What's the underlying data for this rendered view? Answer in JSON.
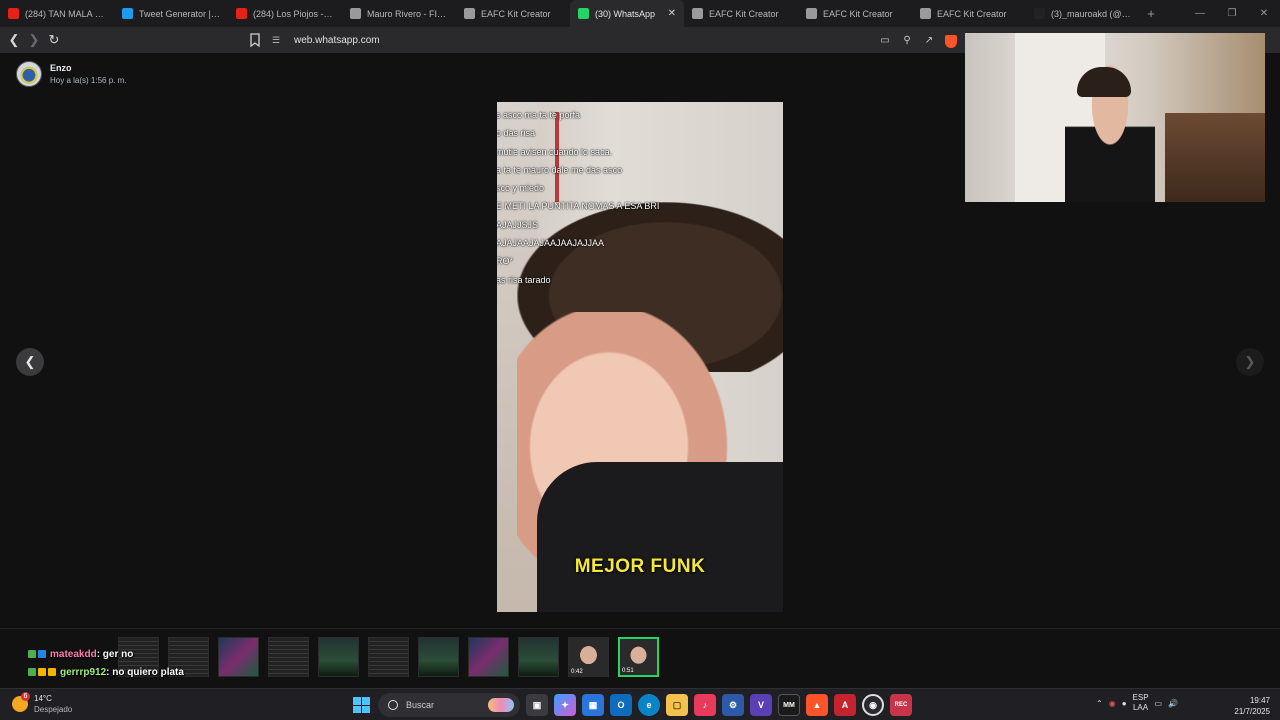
{
  "tabs": [
    {
      "title": "(284) TAN MALA - You",
      "favicon": "youtube-icon",
      "color": "#e62117"
    },
    {
      "title": "Tweet Generator | Twe",
      "favicon": "bird-icon",
      "color": "#1d9bf0"
    },
    {
      "title": "(284) Los Piojos - Pacf",
      "favicon": "youtube-icon",
      "color": "#e62117"
    },
    {
      "title": "Mauro Rivero - FIFA K",
      "favicon": "shirt-icon",
      "color": "#9a9a9e"
    },
    {
      "title": "EAFC Kit Creator",
      "favicon": "shirt-icon",
      "color": "#9a9a9e"
    },
    {
      "title": "(30) WhatsApp",
      "favicon": "whatsapp-icon",
      "color": "#25d366",
      "active": true
    },
    {
      "title": "EAFC Kit Creator",
      "favicon": "shirt-icon",
      "color": "#9a9a9e"
    },
    {
      "title": "EAFC Kit Creator",
      "favicon": "shirt-icon",
      "color": "#9a9a9e"
    },
    {
      "title": "EAFC Kit Creator",
      "favicon": "shirt-icon",
      "color": "#9a9a9e"
    },
    {
      "title": "(3)_mauroakd (@_mau",
      "favicon": "tiktok-icon",
      "color": "#222222"
    }
  ],
  "address": {
    "url": "web.whatsapp.com"
  },
  "sender": {
    "name": "Enzo",
    "time": "Hoy a la(s) 1:56 p. m."
  },
  "media": {
    "overlay_lines": [
      "s asco ma ta te porfa",
      "o das risa",
      "mutie avisen cuando lo saca.",
      "a ta te mauro dale me das asco",
      "sco y miedo",
      "E METI LA PUNTITA NOMAS A ESA BRI",
      "AJAJJSJS",
      "AJAJAAJAJAAJAAJAJJAA",
      "RO*",
      "as risa tarado"
    ],
    "caption": "MEJOR FUNK"
  },
  "chat": [
    {
      "user": "mateakdd",
      "message": ": ger no"
    },
    {
      "user": "gerrrp912",
      "message": ": no quiero plata"
    }
  ],
  "thumbnails": [
    {
      "style": "lines"
    },
    {
      "style": "lines"
    },
    {
      "style": "color"
    },
    {
      "style": "lines"
    },
    {
      "style": "green"
    },
    {
      "style": "lines"
    },
    {
      "style": "green"
    },
    {
      "style": "color"
    },
    {
      "style": "green"
    },
    {
      "style": "face",
      "duration": "0:42"
    },
    {
      "style": "face",
      "duration": "0:51",
      "active": true
    }
  ],
  "weather": {
    "temp": "14°C",
    "condition": "Despejado",
    "badge": "6"
  },
  "taskbar": {
    "search_placeholder": "Buscar"
  },
  "tray": {
    "lang_top": "ESP",
    "lang_bottom": "LAA"
  },
  "clock": {
    "time": "19:47",
    "date": "21/7/2025"
  },
  "colors": {
    "accent": "#25d366",
    "caption_yellow": "#f5e83a"
  }
}
